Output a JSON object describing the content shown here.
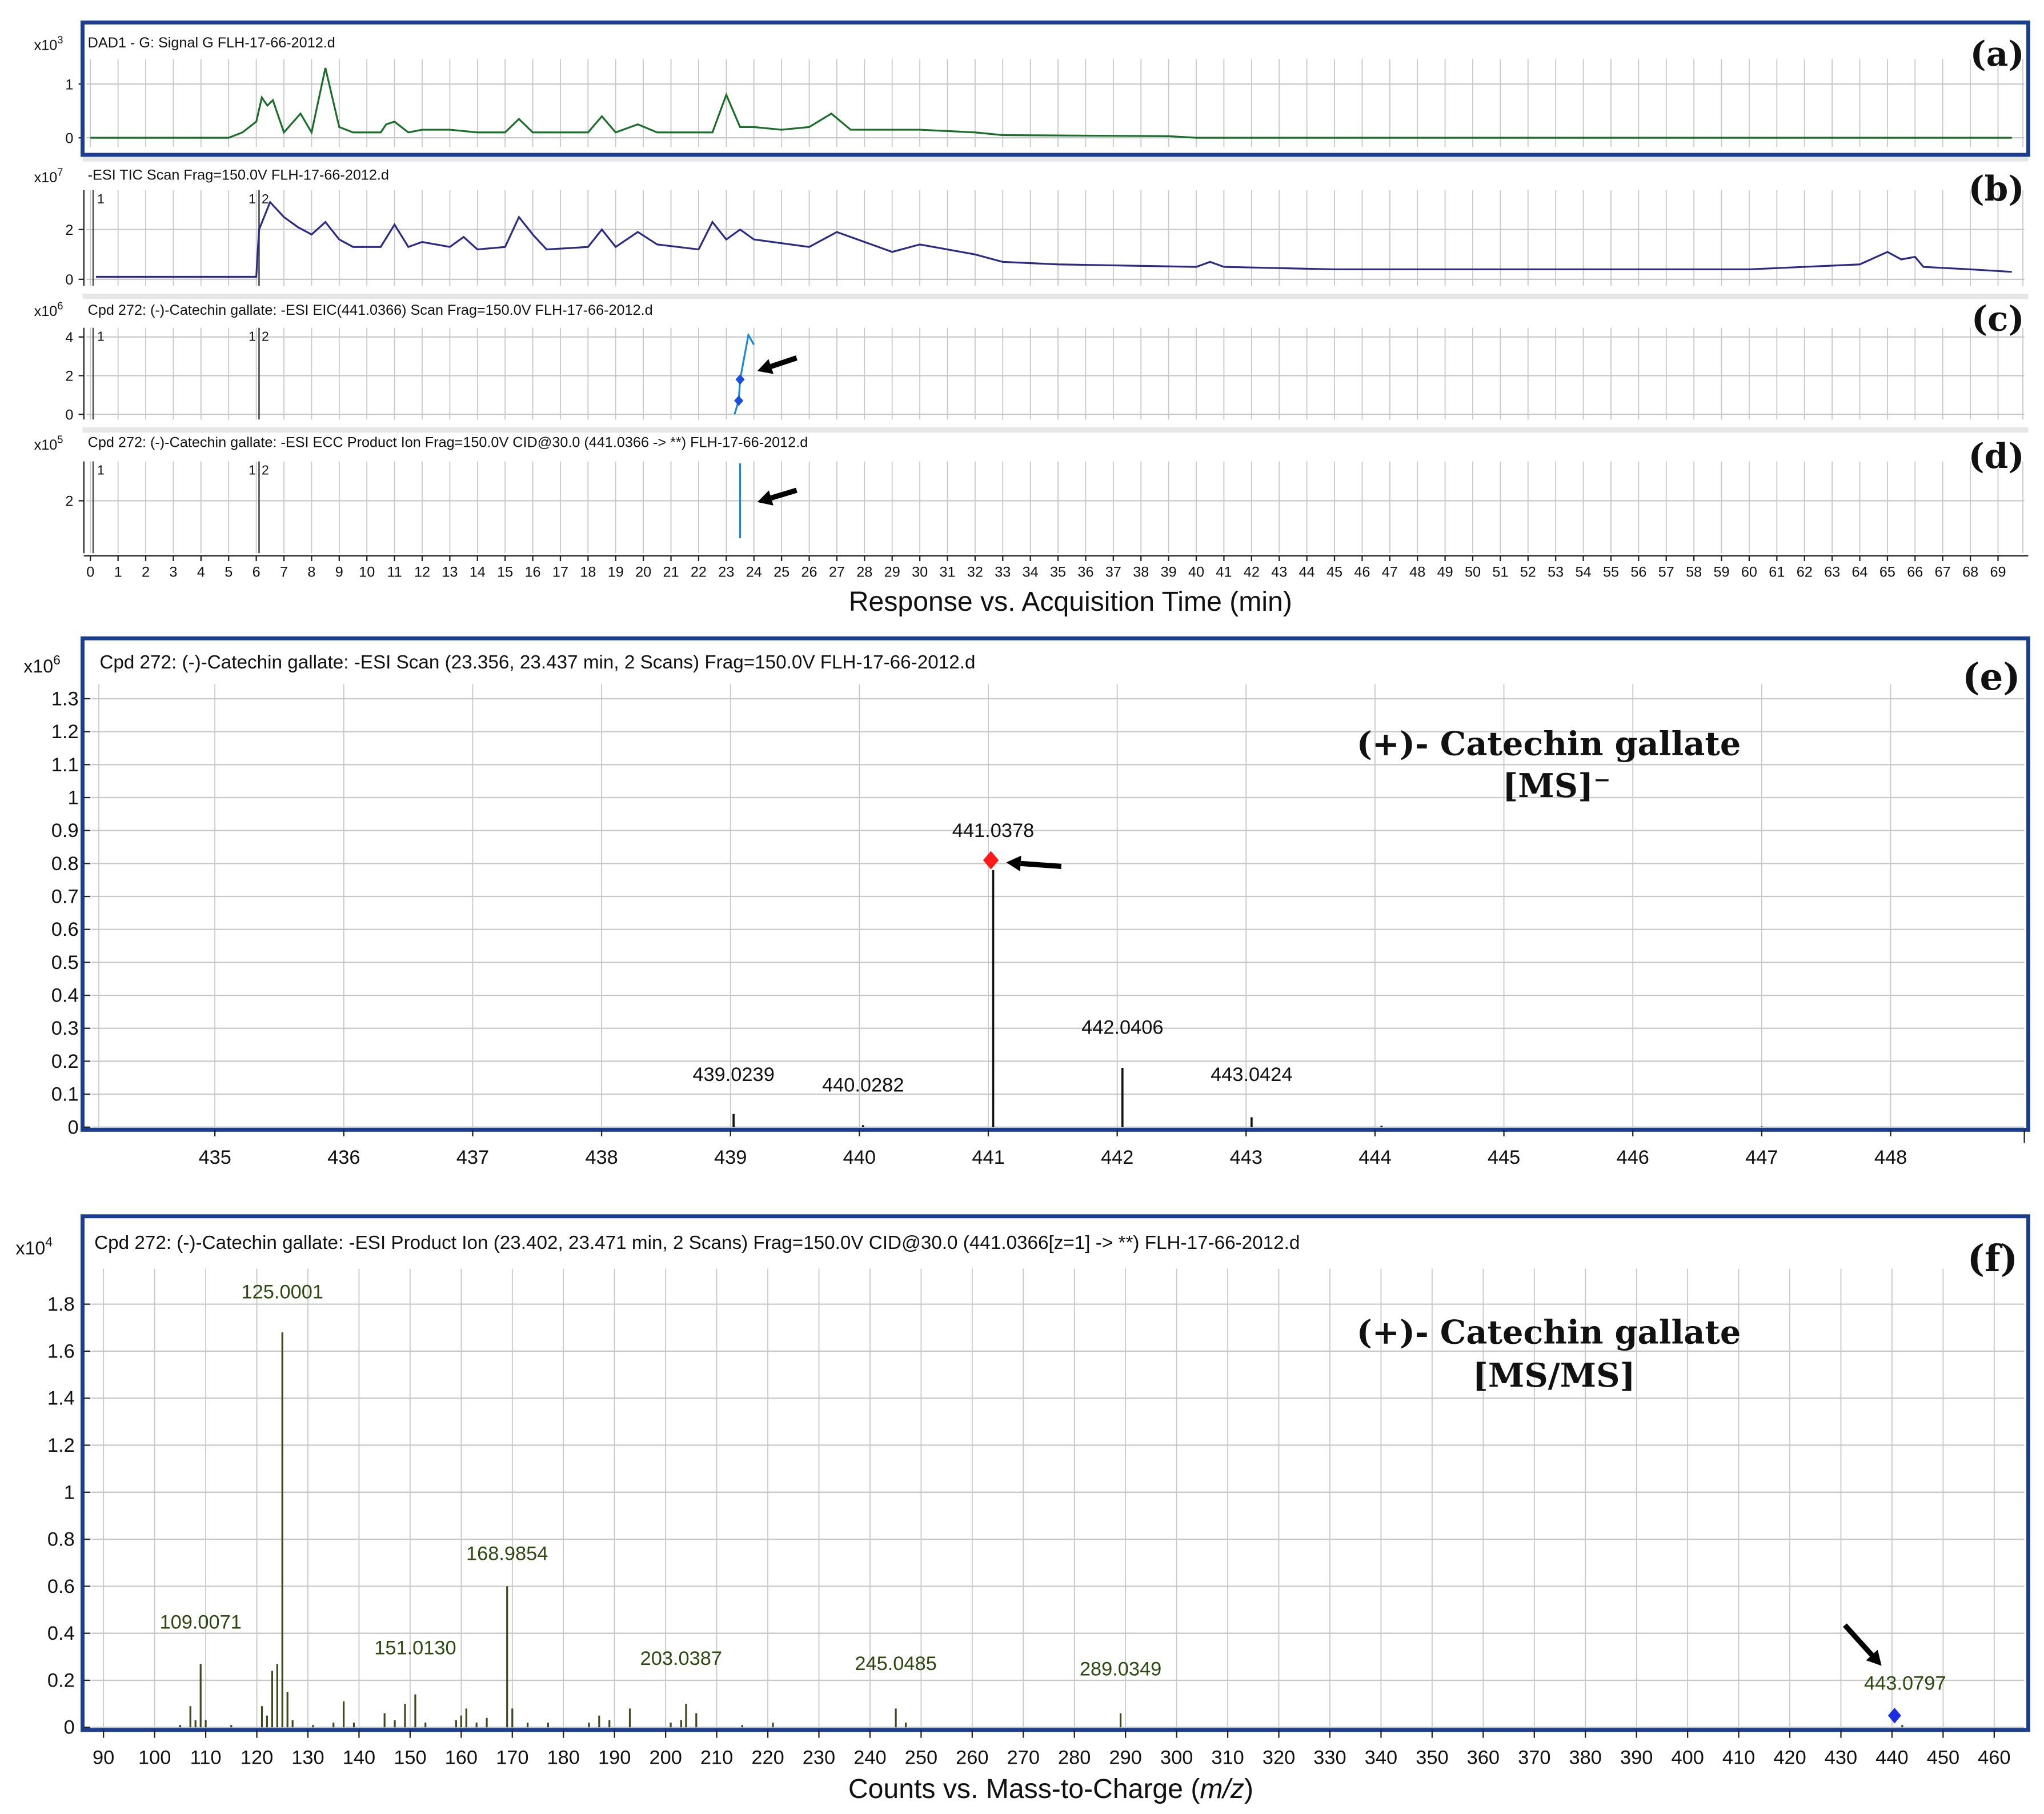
{
  "colors": {
    "frame": "#1a3d8f",
    "dad": "#1a6e2a",
    "tic": "#2b2b86",
    "eic": "#1a8ad4",
    "grid": "#c8c8c8",
    "spectrum_e": "#111111",
    "spectrum_f": "#3c4a1c",
    "label_f": "#2c4a10",
    "marker_red": "#ff1a1a",
    "marker_blue": "#1a2ee0"
  },
  "panel_letters": {
    "a": "(a)",
    "b": "(b)",
    "c": "(c)",
    "d": "(d)",
    "e": "(e)",
    "f": "(f)"
  },
  "chart_data": [
    {
      "id": "a",
      "type": "line",
      "title": "DAD1 - G: Signal G FLH-17-66-2012.d",
      "scale": "x10",
      "exp": "3",
      "yticks": [
        "0",
        "1"
      ],
      "ytick_values": [
        0,
        1
      ],
      "points": [
        [
          0,
          0
        ],
        [
          5,
          0
        ],
        [
          5.5,
          0.1
        ],
        [
          6,
          0.3
        ],
        [
          6.2,
          0.75
        ],
        [
          6.4,
          0.6
        ],
        [
          6.6,
          0.7
        ],
        [
          7,
          0.1
        ],
        [
          7.6,
          0.45
        ],
        [
          8,
          0.1
        ],
        [
          8.5,
          1.3
        ],
        [
          9,
          0.2
        ],
        [
          9.5,
          0.1
        ],
        [
          10.5,
          0.1
        ],
        [
          10.7,
          0.25
        ],
        [
          11,
          0.3
        ],
        [
          11.5,
          0.1
        ],
        [
          12,
          0.15
        ],
        [
          13,
          0.15
        ],
        [
          14,
          0.1
        ],
        [
          15,
          0.1
        ],
        [
          15.5,
          0.35
        ],
        [
          16,
          0.1
        ],
        [
          18,
          0.1
        ],
        [
          18.5,
          0.4
        ],
        [
          19,
          0.1
        ],
        [
          19.8,
          0.25
        ],
        [
          20.5,
          0.1
        ],
        [
          22.5,
          0.1
        ],
        [
          23,
          0.8
        ],
        [
          23.5,
          0.2
        ],
        [
          24,
          0.2
        ],
        [
          25,
          0.15
        ],
        [
          26,
          0.2
        ],
        [
          26.8,
          0.45
        ],
        [
          27.5,
          0.15
        ],
        [
          30,
          0.15
        ],
        [
          32,
          0.1
        ],
        [
          33,
          0.05
        ],
        [
          39,
          0.03
        ],
        [
          40,
          0
        ],
        [
          69.5,
          0
        ]
      ]
    },
    {
      "id": "b",
      "type": "line",
      "title": "-ESI TIC Scan Frag=150.0V FLH-17-66-2012.d",
      "scale": "x10",
      "exp": "7",
      "yticks": [
        "0",
        "2"
      ],
      "ytick_values": [
        0,
        2
      ],
      "segment_labels": [
        "1",
        "1",
        "2"
      ],
      "points": [
        [
          0.2,
          0.1
        ],
        [
          6,
          0.1
        ],
        [
          6.1,
          2
        ],
        [
          6.5,
          3.1
        ],
        [
          7,
          2.5
        ],
        [
          7.5,
          2.1
        ],
        [
          8,
          1.8
        ],
        [
          8.5,
          2.3
        ],
        [
          9,
          1.6
        ],
        [
          9.5,
          1.3
        ],
        [
          10.5,
          1.3
        ],
        [
          11,
          2.2
        ],
        [
          11.5,
          1.3
        ],
        [
          12,
          1.5
        ],
        [
          13,
          1.3
        ],
        [
          13.5,
          1.7
        ],
        [
          14,
          1.2
        ],
        [
          15,
          1.3
        ],
        [
          15.5,
          2.5
        ],
        [
          16,
          1.8
        ],
        [
          16.5,
          1.2
        ],
        [
          18,
          1.3
        ],
        [
          18.5,
          2.0
        ],
        [
          19,
          1.3
        ],
        [
          19.8,
          1.9
        ],
        [
          20.5,
          1.4
        ],
        [
          22,
          1.2
        ],
        [
          22.5,
          2.3
        ],
        [
          23,
          1.6
        ],
        [
          23.5,
          2.0
        ],
        [
          24,
          1.6
        ],
        [
          26,
          1.3
        ],
        [
          27,
          1.9
        ],
        [
          28,
          1.5
        ],
        [
          29,
          1.1
        ],
        [
          30,
          1.4
        ],
        [
          32,
          1.0
        ],
        [
          33,
          0.7
        ],
        [
          35,
          0.6
        ],
        [
          40,
          0.5
        ],
        [
          40.5,
          0.7
        ],
        [
          41,
          0.5
        ],
        [
          45,
          0.4
        ],
        [
          60,
          0.4
        ],
        [
          64,
          0.6
        ],
        [
          65,
          1.1
        ],
        [
          65.5,
          0.8
        ],
        [
          66,
          0.9
        ],
        [
          66.3,
          0.5
        ],
        [
          68,
          0.4
        ],
        [
          69.5,
          0.3
        ]
      ]
    },
    {
      "id": "c",
      "type": "line",
      "title": "Cpd 272: (-)-Catechin gallate: -ESI EIC(441.0366) Scan Frag=150.0V FLH-17-66-2012.d",
      "scale": "x10",
      "exp": "6",
      "yticks": [
        "0",
        "2",
        "4"
      ],
      "ytick_values": [
        0,
        2,
        4
      ],
      "segment_labels": [
        "1",
        "1",
        "2"
      ],
      "points": [
        [
          23.3,
          0
        ],
        [
          23.45,
          0.7
        ],
        [
          23.5,
          1.8
        ],
        [
          23.8,
          4.1
        ],
        [
          24,
          3.6
        ]
      ],
      "markers": [
        [
          23.45,
          0.7
        ],
        [
          23.5,
          1.8
        ]
      ]
    },
    {
      "id": "d",
      "type": "line",
      "title": "Cpd 272: (-)-Catechin gallate: -ESI ECC Product Ion Frag=150.0V CID@30.0 (441.0366 -> **) FLH-17-66-2012.d",
      "scale": "x10",
      "exp": "5",
      "yticks": [
        "2"
      ],
      "ytick_values": [
        2
      ],
      "segment_labels": [
        "1",
        "1",
        "2"
      ],
      "points": [
        [
          23.5,
          0.5
        ],
        [
          23.5,
          3.5
        ]
      ]
    },
    {
      "id": "time_axis",
      "xlabel": "Response vs. Acquisition Time (min)",
      "xlim": [
        0,
        69
      ]
    },
    {
      "id": "e",
      "type": "bar",
      "title": "Cpd 272: (-)-Catechin gallate: -ESI Scan (23.356, 23.437 min, 2 Scans) Frag=150.0V FLH-17-66-2012.d",
      "scale": "x10",
      "exp": "6",
      "annotation": "(+)- Catechin gallate",
      "annotation2": "[MS]⁻",
      "yticks": [
        "0",
        "0.1",
        "0.2",
        "0.3",
        "0.4",
        "0.5",
        "0.6",
        "0.7",
        "0.8",
        "0.9",
        "1",
        "1.1",
        "1.2",
        "1.3"
      ],
      "xticks": [
        "435",
        "436",
        "437",
        "438",
        "439",
        "440",
        "441",
        "442",
        "443",
        "444",
        "445",
        "446",
        "447",
        "448"
      ],
      "peaks": [
        {
          "mz": 439.0239,
          "v": 0.04,
          "label": "439.0239"
        },
        {
          "mz": 440.0282,
          "v": 0.006,
          "label": "440.0282"
        },
        {
          "mz": 441.0378,
          "v": 0.78,
          "label": "441.0378"
        },
        {
          "mz": 442.0406,
          "v": 0.18,
          "label": "442.0406"
        },
        {
          "mz": 443.0424,
          "v": 0.03,
          "label": "443.0424"
        },
        {
          "mz": 444.05,
          "v": 0.004
        },
        {
          "mz": 447.0,
          "v": 0.002
        }
      ],
      "marker": {
        "mz": 441.0,
        "v": 0.81
      }
    },
    {
      "id": "f",
      "type": "bar",
      "title": "Cpd 272: (-)-Catechin gallate: -ESI Product Ion (23.402, 23.471 min, 2 Scans) Frag=150.0V CID@30.0 (441.0366[z=1] -> **) FLH-17-66-2012.d",
      "scale": "x10",
      "exp": "4",
      "annotation": "(+)- Catechin gallate",
      "annotation2": "[MS/MS]",
      "xlabel_pre": "Counts vs. Mass-to-Charge (",
      "xlabel_it": "m/z",
      "xlabel_post": ")",
      "yticks": [
        "0",
        "0.2",
        "0.4",
        "0.6",
        "0.8",
        "1",
        "1.2",
        "1.4",
        "1.6",
        "1.8"
      ],
      "xticks": [
        "90",
        "100",
        "110",
        "120",
        "130",
        "140",
        "150",
        "160",
        "170",
        "180",
        "190",
        "200",
        "210",
        "220",
        "230",
        "240",
        "250",
        "260",
        "270",
        "280",
        "290",
        "300",
        "310",
        "320",
        "330",
        "340",
        "350",
        "360",
        "370",
        "380",
        "390",
        "400",
        "410",
        "420",
        "430",
        "440",
        "450",
        "460"
      ],
      "peaks": [
        {
          "mz": 105,
          "v": 0.01
        },
        {
          "mz": 107,
          "v": 0.09
        },
        {
          "mz": 108,
          "v": 0.03
        },
        {
          "mz": 109.0071,
          "v": 0.27,
          "label": "109.0071"
        },
        {
          "mz": 110,
          "v": 0.03
        },
        {
          "mz": 115,
          "v": 0.01
        },
        {
          "mz": 121,
          "v": 0.09
        },
        {
          "mz": 122,
          "v": 0.05
        },
        {
          "mz": 123,
          "v": 0.24
        },
        {
          "mz": 124,
          "v": 0.27
        },
        {
          "mz": 125.0001,
          "v": 1.68,
          "label": "125.0001"
        },
        {
          "mz": 126,
          "v": 0.15
        },
        {
          "mz": 127,
          "v": 0.03
        },
        {
          "mz": 131,
          "v": 0.01
        },
        {
          "mz": 135,
          "v": 0.02
        },
        {
          "mz": 137,
          "v": 0.11
        },
        {
          "mz": 139,
          "v": 0.02
        },
        {
          "mz": 145,
          "v": 0.06
        },
        {
          "mz": 147,
          "v": 0.03
        },
        {
          "mz": 149,
          "v": 0.1
        },
        {
          "mz": 151.013,
          "v": 0.14,
          "label": "151.0130"
        },
        {
          "mz": 153,
          "v": 0.02
        },
        {
          "mz": 159,
          "v": 0.03
        },
        {
          "mz": 160,
          "v": 0.05
        },
        {
          "mz": 161,
          "v": 0.08
        },
        {
          "mz": 163,
          "v": 0.02
        },
        {
          "mz": 165,
          "v": 0.04
        },
        {
          "mz": 168.9854,
          "v": 0.6,
          "label": "168.9854"
        },
        {
          "mz": 170,
          "v": 0.08
        },
        {
          "mz": 173,
          "v": 0.02
        },
        {
          "mz": 177,
          "v": 0.02
        },
        {
          "mz": 185,
          "v": 0.02
        },
        {
          "mz": 187,
          "v": 0.05
        },
        {
          "mz": 189,
          "v": 0.03
        },
        {
          "mz": 193,
          "v": 0.08
        },
        {
          "mz": 201,
          "v": 0.02
        },
        {
          "mz": 203.0387,
          "v": 0.03,
          "label": "203.0387"
        },
        {
          "mz": 204,
          "v": 0.1
        },
        {
          "mz": 206,
          "v": 0.06
        },
        {
          "mz": 215,
          "v": 0.01
        },
        {
          "mz": 221,
          "v": 0.02
        },
        {
          "mz": 245.0485,
          "v": 0.08,
          "label": "245.0485"
        },
        {
          "mz": 247,
          "v": 0.02
        },
        {
          "mz": 289.0349,
          "v": 0.06,
          "label": "289.0349"
        },
        {
          "mz": 442,
          "v": 0.01
        }
      ],
      "marker": {
        "mz": 440.5,
        "v": 0.05,
        "label": "443.0797"
      }
    }
  ]
}
